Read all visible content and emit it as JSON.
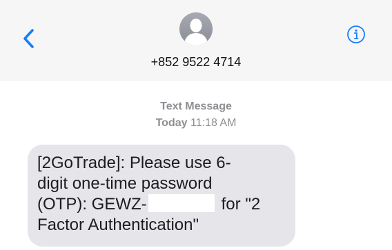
{
  "header": {
    "contact": "+852 9522 4714",
    "back_icon": "chevron-left-icon",
    "info_icon": "info-circle-icon",
    "accent_color": "#147efb"
  },
  "meta": {
    "type": "Text Message",
    "day": "Today",
    "time": "11:18 AM"
  },
  "message": {
    "line1": "[2GoTrade]: Please use 6-",
    "line2": "digit one-time password",
    "line3_prefix": "(OTP): GEWZ-",
    "line3_suffix": "for \"2",
    "line4": "Factor Authentication\"",
    "bubble_color": "#e5e5ea"
  }
}
